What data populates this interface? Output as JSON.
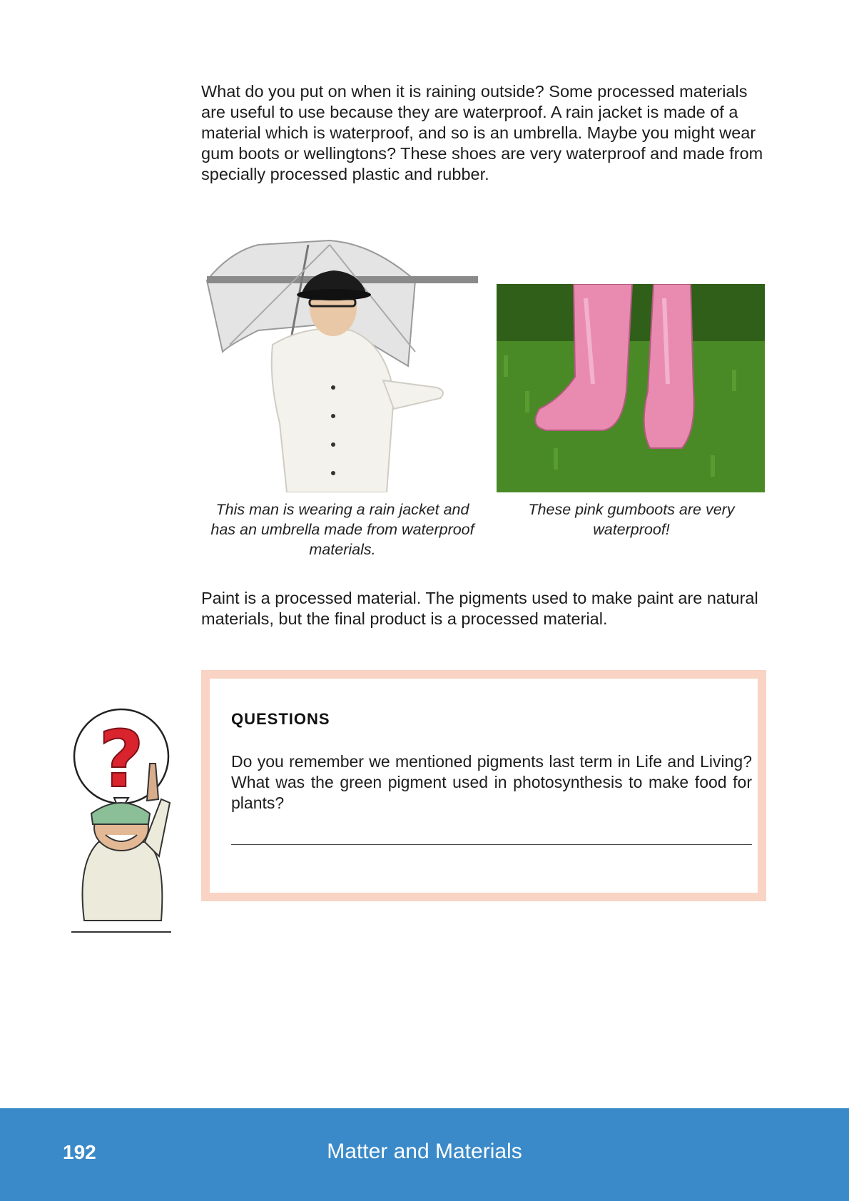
{
  "body": {
    "paragraph1": "What do you put on when it is raining outside? Some processed materials are useful to use because they are waterproof. A rain jacket is made of a material which is waterproof, and so is an umbrella. Maybe you might wear gum boots or wellingtons? These shoes are very waterproof and made from specially processed plastic and rubber.",
    "paragraph2": "Paint is a processed material. The pigments used to make paint are natural materials, but the final product is a processed material."
  },
  "figures": [
    {
      "caption": "This man is wearing a rain jacket and has an umbrella made from waterproof materials."
    },
    {
      "caption": "These pink gumboots are very waterproof!"
    }
  ],
  "questions": {
    "title": "QUESTIONS",
    "text": "Do you remember we mentioned pigments last term in Life and Living? What was the green pigment used in photosynthesis to make food for plants?"
  },
  "footer": {
    "page_number": "192",
    "title": "Matter and Materials"
  },
  "colors": {
    "footer_bg": "#3a8ac9",
    "question_border": "#f9d3c4"
  }
}
